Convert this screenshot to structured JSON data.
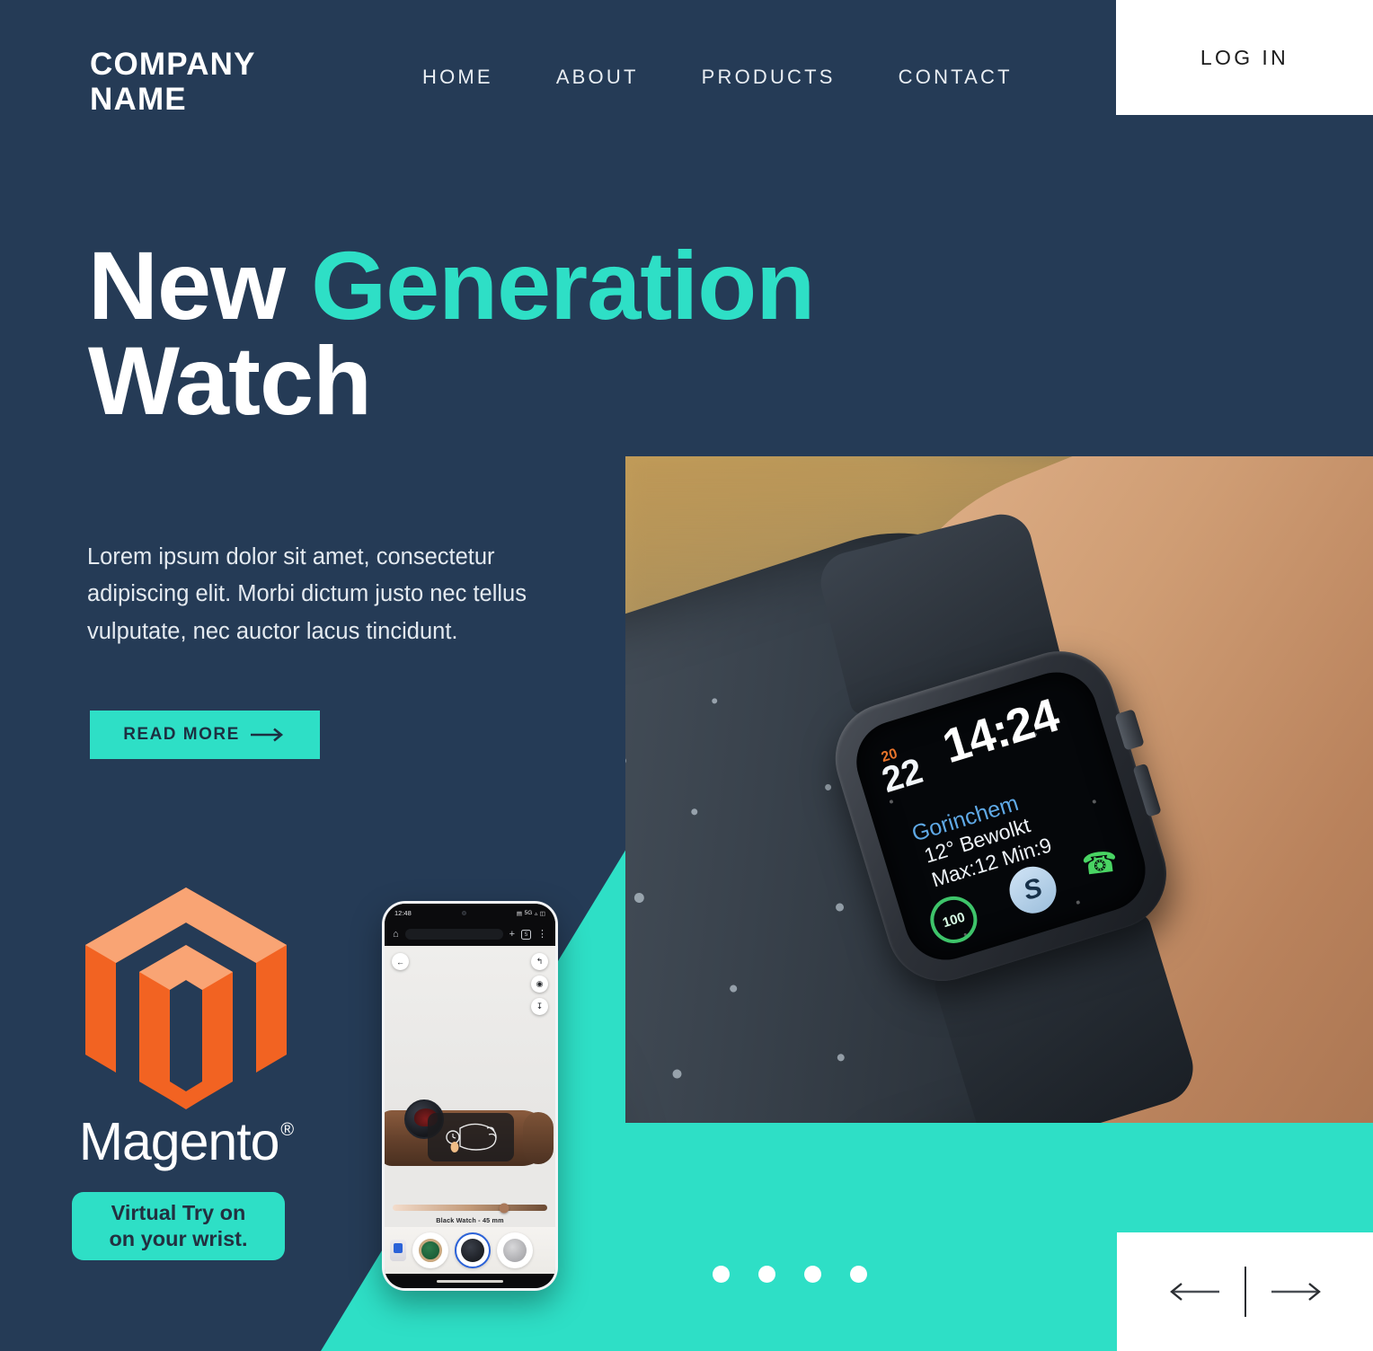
{
  "theme": {
    "navy": "#253b56",
    "teal": "#2edfc6",
    "white": "#ffffff",
    "dark_text": "#1d2f41",
    "magento_orange": "#f26322"
  },
  "header": {
    "logo_line1": "COMPANY",
    "logo_line2": "NAME",
    "nav": [
      {
        "label": "HOME"
      },
      {
        "label": "ABOUT"
      },
      {
        "label": "PRODUCTS"
      },
      {
        "label": "CONTACT"
      }
    ],
    "login_label": "LOG IN"
  },
  "hero": {
    "title_part1": "New ",
    "title_part2": "Generation",
    "title_part3": "Watch",
    "paragraph": "Lorem ipsum dolor sit amet, consectetur adipiscing elit. Morbi dictum justo nec tellus vulputate, nec auctor lacus tincidunt.",
    "cta_label": "READ MORE",
    "cta_icon": "arrow-right-icon"
  },
  "brand": {
    "magento_name": "Magento",
    "magento_trademark": "®",
    "badge_line1": "Virtual Try on",
    "badge_line2": "on your wrist."
  },
  "watch_photo": {
    "alt": "smartwatch-on-wrist-photo",
    "face": {
      "date_badge": "20",
      "date": "22",
      "time": "14:24",
      "city": "Gorinchem",
      "condition": "12° Bewolkt",
      "minmax": "Max:12 Min:9",
      "activity_value": "100",
      "shazam_icon": "shazam-icon",
      "phone_icon": "phone-icon"
    }
  },
  "phone": {
    "status": {
      "time": "12:48",
      "network": "5G",
      "signal_icon": "signal-icon",
      "battery_icon": "battery-icon",
      "sim_icon": "sim-icon"
    },
    "chrome": {
      "home_icon": "home-icon",
      "new_tab_icon": "plus-icon",
      "tabs_icon": "tabs-icon",
      "tabs_count": "5",
      "menu_icon": "kebab-menu-icon"
    },
    "viewer": {
      "back_icon": "back-arrow-icon",
      "share_icon": "share-icon",
      "camera_icon": "camera-icon",
      "download_icon": "download-icon",
      "hint_icon": "wrist-tap-hint-icon",
      "caption": "Black Watch - 45 mm",
      "slider_value": 72,
      "thumbnails": [
        {
          "name": "green-chronograph-watch",
          "selected": false
        },
        {
          "name": "black-chronograph-watch",
          "selected": true
        },
        {
          "name": "silver-watch",
          "selected": false
        }
      ]
    }
  },
  "carousel": {
    "dots": [
      {
        "active": true
      },
      {
        "active": false
      },
      {
        "active": false
      },
      {
        "active": false
      }
    ],
    "prev_icon": "arrow-left-icon",
    "next_icon": "arrow-right-icon"
  }
}
